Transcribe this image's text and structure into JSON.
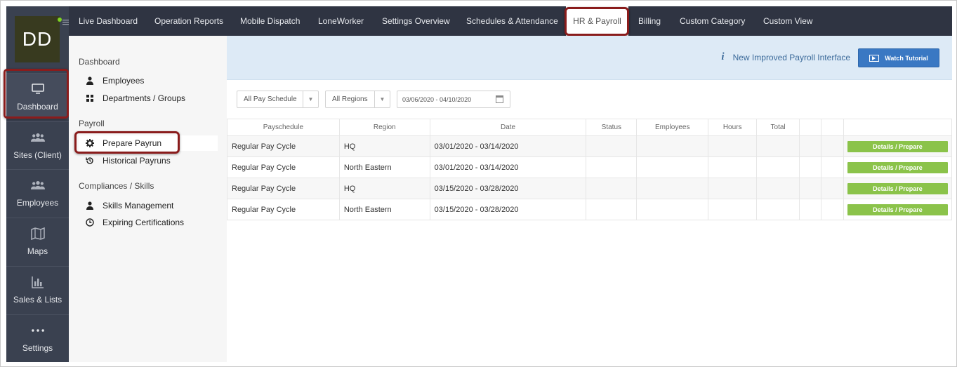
{
  "rail": {
    "avatar": "DD",
    "items": [
      {
        "label": "Dashboard",
        "icon": "monitor-icon"
      },
      {
        "label": "Sites (Client)",
        "icon": "people-icon"
      },
      {
        "label": "Employees",
        "icon": "people-icon"
      },
      {
        "label": "Maps",
        "icon": "map-icon"
      },
      {
        "label": "Sales & Lists",
        "icon": "bar-chart-icon"
      },
      {
        "label": "Settings",
        "icon": "dots-icon"
      }
    ]
  },
  "topnav": {
    "tabs": [
      "Live Dashboard",
      "Operation Reports",
      "Mobile Dispatch",
      "LoneWorker",
      "Settings Overview",
      "Schedules & Attendance",
      "HR & Payroll",
      "Billing",
      "Custom Category",
      "Custom View"
    ],
    "active": "HR & Payroll"
  },
  "sidebar": {
    "dashboard_heading": "Dashboard",
    "employees": "Employees",
    "departments": "Departments / Groups",
    "payroll_heading": "Payroll",
    "prepare_payrun": "Prepare Payrun",
    "historical_payruns": "Historical Payruns",
    "compliances_heading": "Compliances / Skills",
    "skills_management": "Skills Management",
    "expiring_certifications": "Expiring Certifications"
  },
  "banner": {
    "text": "New Improved Payroll Interface",
    "button": "Watch Tutorial"
  },
  "filters": {
    "pay_schedule": "All Pay Schedule",
    "regions": "All Regions",
    "date_range": "03/06/2020 - 04/10/2020"
  },
  "table": {
    "headers": [
      "Payschedule",
      "Region",
      "Date",
      "Status",
      "Employees",
      "Hours",
      "Total",
      "",
      "",
      ""
    ],
    "rows": [
      {
        "payschedule": "Regular Pay Cycle",
        "region": "HQ",
        "date": "03/01/2020 - 03/14/2020",
        "action": "Details / Prepare"
      },
      {
        "payschedule": "Regular Pay Cycle",
        "region": "North Eastern",
        "date": "03/01/2020 - 03/14/2020",
        "action": "Details / Prepare"
      },
      {
        "payschedule": "Regular Pay Cycle",
        "region": "HQ",
        "date": "03/15/2020 - 03/28/2020",
        "action": "Details / Prepare"
      },
      {
        "payschedule": "Regular Pay Cycle",
        "region": "North Eastern",
        "date": "03/15/2020 - 03/28/2020",
        "action": "Details / Prepare"
      }
    ]
  },
  "colors": {
    "rail_bg": "#3a4150",
    "topnav_bg": "#2f3442",
    "banner_bg": "#ddeaf6",
    "accent_blue": "#3a78c3",
    "action_green": "#8bc34a",
    "highlight_red": "#8a1c1c"
  }
}
